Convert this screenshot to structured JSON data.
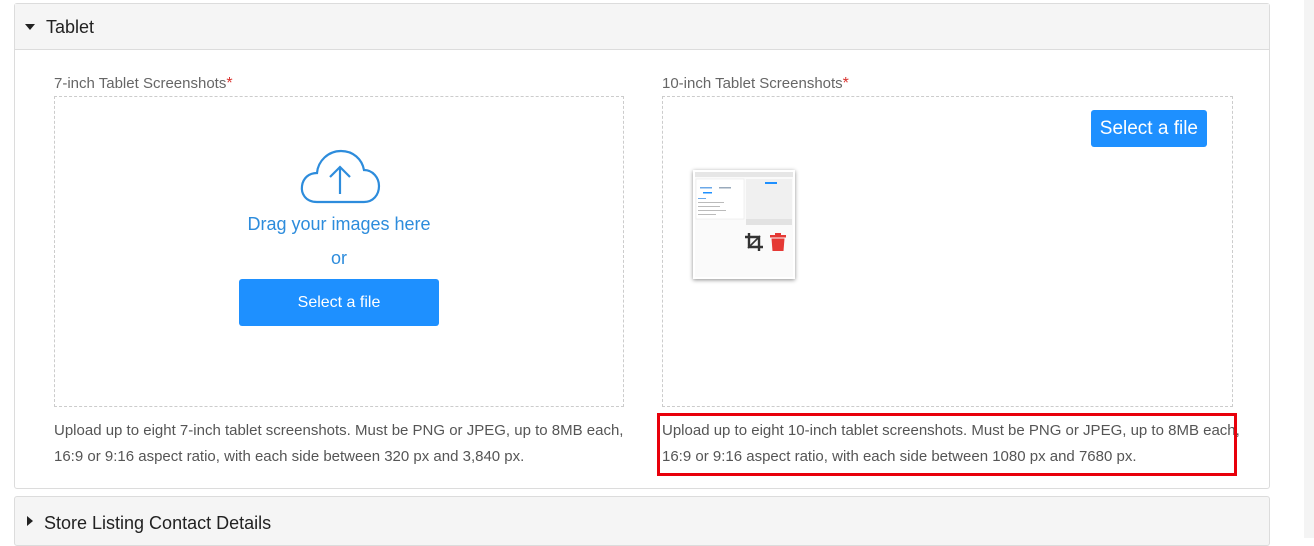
{
  "tablet_section": {
    "title": "Tablet",
    "seven_inch": {
      "label": "7-inch Tablet Screenshots",
      "required_mark": "*",
      "drag_text": "Drag your images here",
      "or_text": "or",
      "select_button": "Select a file",
      "help_line1": "Upload up to eight 7-inch tablet screenshots. Must be PNG or JPEG, up to 8MB each,",
      "help_line2": "16:9 or 9:16 aspect ratio, with each side between 320 px and 3,840 px."
    },
    "ten_inch": {
      "label": "10-inch Tablet Screenshots",
      "required_mark": "*",
      "select_button": "Select a file",
      "help_line1": "Upload up to eight 10-inch tablet screenshots. Must be PNG or JPEG, up to 8MB each,",
      "help_line2": "16:9 or 9:16 aspect ratio, with each side between 1080 px and 7680 px."
    }
  },
  "contact_section": {
    "title": "Store Listing Contact Details"
  },
  "icons": {
    "collapse": "caret-down-icon",
    "expand": "caret-right-icon",
    "upload": "cloud-upload-icon",
    "crop": "crop-icon",
    "delete": "trash-icon"
  },
  "colors": {
    "accent": "#1e90ff",
    "link_text": "#2d8cdc",
    "required": "#d9302c",
    "delete": "#e53935",
    "highlight": "#e8000b"
  }
}
